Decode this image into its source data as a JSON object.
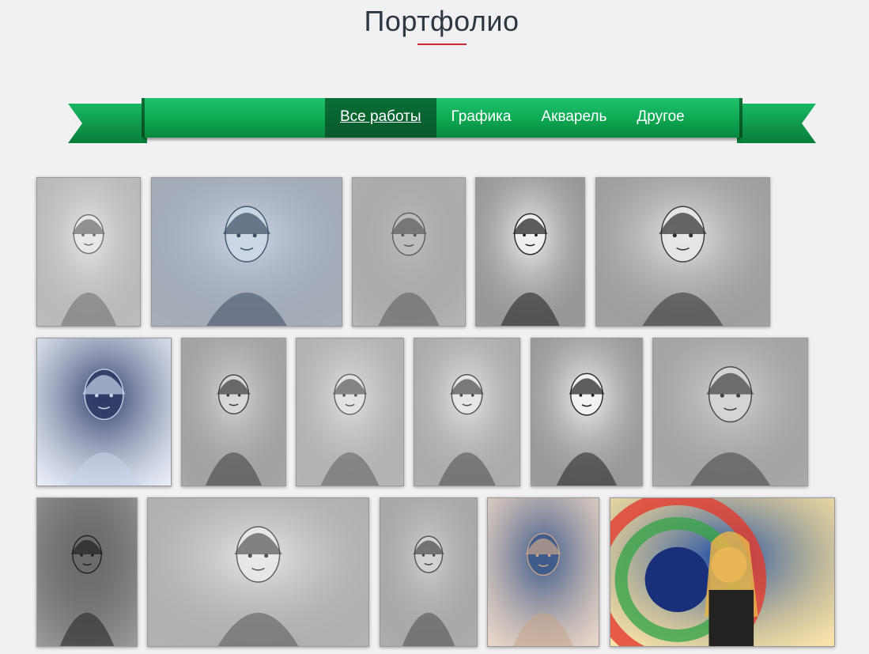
{
  "page": {
    "title": "Портфолио"
  },
  "nav": {
    "items": [
      {
        "label": "Все работы",
        "active": true
      },
      {
        "label": "Графика",
        "active": false
      },
      {
        "label": "Акварель",
        "active": false
      },
      {
        "label": "Другое",
        "active": false
      }
    ]
  },
  "colors": {
    "ribbon_green": "#0ea752",
    "ribbon_dark": "#07592b",
    "title_text": "#2e3742",
    "underline_accent": "#c62a2a"
  },
  "gallery": {
    "items": [
      {
        "subject": "girl-portrait",
        "palette": [
          "#e9e9ea",
          "#6b6b6b"
        ]
      },
      {
        "subject": "pianist",
        "palette": [
          "#cdd8e6",
          "#3e4d63"
        ]
      },
      {
        "subject": "man-portrait",
        "palette": [
          "#bdbdbd",
          "#5a5a5a"
        ]
      },
      {
        "subject": "girl-black-shirt",
        "palette": [
          "#f2f2f2",
          "#1c1c1c"
        ]
      },
      {
        "subject": "woman-hood",
        "palette": [
          "#e8e8e8",
          "#2e2e2e"
        ]
      },
      {
        "subject": "man-blue-dark",
        "palette": [
          "#2f3b66",
          "#c9d4ea"
        ]
      },
      {
        "subject": "curly-woman",
        "palette": [
          "#d9d9d9",
          "#3b3b3b"
        ]
      },
      {
        "subject": "man-sketch",
        "palette": [
          "#e4e4e4",
          "#5c5c5c"
        ]
      },
      {
        "subject": "man-sketch-2",
        "palette": [
          "#e8e8e8",
          "#4a4a4a"
        ]
      },
      {
        "subject": "woman-ponytail",
        "palette": [
          "#f5f5f5",
          "#1f1f1f"
        ]
      },
      {
        "subject": "man-window",
        "palette": [
          "#d6d6d6",
          "#404040"
        ]
      },
      {
        "subject": "boy-portrait",
        "palette": [
          "#6b6b6b",
          "#1f1f1f"
        ]
      },
      {
        "subject": "reclining-woman",
        "palette": [
          "#e9e9e9",
          "#555555"
        ]
      },
      {
        "subject": "man-striped-shirt",
        "palette": [
          "#d3d3d3",
          "#4a4a4a"
        ]
      },
      {
        "subject": "man-blue-watercolor",
        "palette": [
          "#3d5a8c",
          "#c9a58a"
        ]
      },
      {
        "subject": "blonde-wheel",
        "palette": [
          "#1f4fa8",
          "#f0c244"
        ]
      }
    ]
  }
}
